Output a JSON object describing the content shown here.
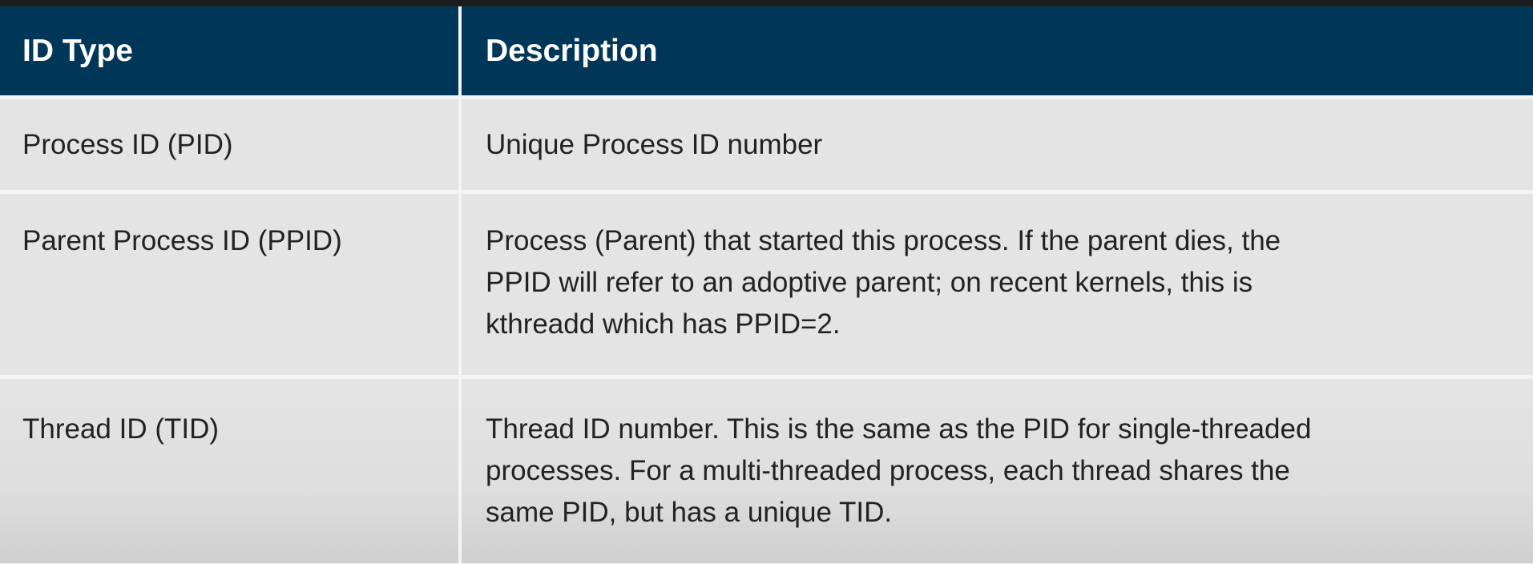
{
  "table": {
    "headers": [
      "ID Type",
      "Description"
    ],
    "rows": [
      {
        "id_type": "Process ID (PID)",
        "description": "Unique Process ID number"
      },
      {
        "id_type": "Parent Process ID (PPID)",
        "description": "Process (Parent) that started this process. If the parent dies, the PPID will refer to an adoptive parent; on recent kernels, this is kthreadd which has PPID=2."
      },
      {
        "id_type": "Thread ID (TID)",
        "description": "Thread ID number. This is the same as the PID for single-threaded processes. For a multi-threaded process, each thread shares the same PID, but has a unique TID."
      }
    ]
  }
}
